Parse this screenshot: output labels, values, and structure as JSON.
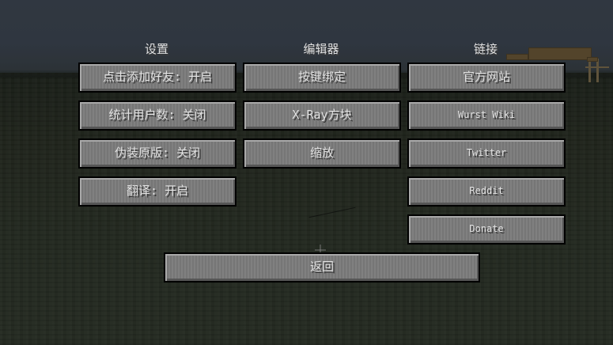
{
  "columns": {
    "settings": {
      "heading": "设置",
      "buttons": [
        "点击添加好友: 开启",
        "统计用户数: 关闭",
        "伪装原版: 关闭",
        "翻译: 开启"
      ]
    },
    "editors": {
      "heading": "编辑器",
      "buttons": [
        "按键绑定",
        "X-Ray方块",
        "缩放"
      ]
    },
    "links": {
      "heading": "链接",
      "buttons": [
        "官方网站",
        "Wurst Wiki",
        "Twitter",
        "Reddit",
        "Donate"
      ]
    }
  },
  "back_button": "返回",
  "colors": {
    "button_face": "#7b7b7b",
    "button_border": "#000000",
    "text": "#e0e0e0"
  }
}
